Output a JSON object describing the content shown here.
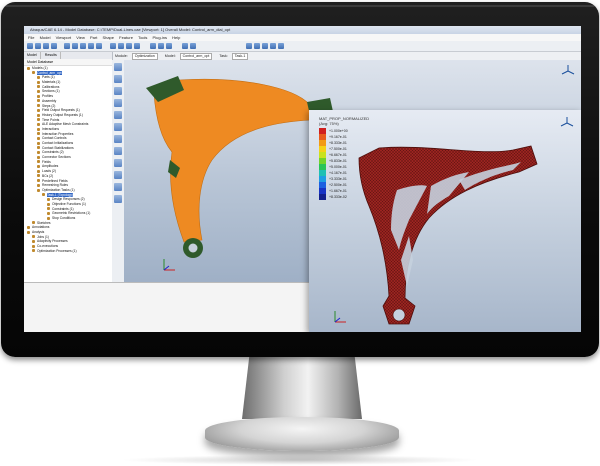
{
  "window": {
    "title": "Abaqus/CAE 6.14 - Model Database: C:\\TEMP\\Dual-Lines.cae [Viewport: 1]  Overall Model: Control_arm_dial_opt"
  },
  "menu": [
    "File",
    "Model",
    "Viewport",
    "View",
    "Part",
    "Shape",
    "Feature",
    "Tools",
    "Plug-ins",
    "Help"
  ],
  "toolbar2": {
    "module_label": "Module:",
    "module_value": "Optimization",
    "model_label": "Model:",
    "model_value": "Control_arm_opt",
    "task_label": "Task:",
    "task_value": "Task-1"
  },
  "tabs": [
    "Model",
    "Results"
  ],
  "tree": {
    "header": "Model Database",
    "items": [
      {
        "label": "Models (1)",
        "indent": 0
      },
      {
        "label": "Control_arm_opt",
        "indent": 1,
        "selected": true
      },
      {
        "label": "Parts (1)",
        "indent": 2
      },
      {
        "label": "Materials (1)",
        "indent": 2
      },
      {
        "label": "Calibrations",
        "indent": 2
      },
      {
        "label": "Sections (1)",
        "indent": 2
      },
      {
        "label": "Profiles",
        "indent": 2
      },
      {
        "label": "Assembly",
        "indent": 2
      },
      {
        "label": "Steps (2)",
        "indent": 2
      },
      {
        "label": "Field Output Requests (1)",
        "indent": 2
      },
      {
        "label": "History Output Requests (1)",
        "indent": 2
      },
      {
        "label": "Time Points",
        "indent": 2
      },
      {
        "label": "ALE Adaptive Mesh Constraints",
        "indent": 2
      },
      {
        "label": "Interactions",
        "indent": 2
      },
      {
        "label": "Interaction Properties",
        "indent": 2
      },
      {
        "label": "Contact Controls",
        "indent": 2
      },
      {
        "label": "Contact Initializations",
        "indent": 2
      },
      {
        "label": "Contact Stabilizations",
        "indent": 2
      },
      {
        "label": "Constraints (2)",
        "indent": 2
      },
      {
        "label": "Connector Sections",
        "indent": 2
      },
      {
        "label": "Fields",
        "indent": 2
      },
      {
        "label": "Amplitudes",
        "indent": 2
      },
      {
        "label": "Loads (2)",
        "indent": 2
      },
      {
        "label": "BCs (2)",
        "indent": 2
      },
      {
        "label": "Predefined Fields",
        "indent": 2
      },
      {
        "label": "Remeshing Rules",
        "indent": 2
      },
      {
        "label": "Optimization Tasks (1)",
        "indent": 2
      },
      {
        "label": "Task-1 (Topology)",
        "indent": 3,
        "selected": true
      },
      {
        "label": "Design Responses (2)",
        "indent": 4
      },
      {
        "label": "Objective Functions (1)",
        "indent": 4
      },
      {
        "label": "Constraints (1)",
        "indent": 4
      },
      {
        "label": "Geometric Restrictions (1)",
        "indent": 4
      },
      {
        "label": "Stop Conditions",
        "indent": 4
      },
      {
        "label": "Sketches",
        "indent": 1
      },
      {
        "label": "Annotations",
        "indent": 0
      },
      {
        "label": "Analysis",
        "indent": 0
      },
      {
        "label": "Jobs (1)",
        "indent": 1
      },
      {
        "label": "Adaptivity Processes",
        "indent": 1
      },
      {
        "label": "Co-executions",
        "indent": 1
      },
      {
        "label": "Optimization Processes (1)",
        "indent": 1
      }
    ]
  },
  "result": {
    "title": "MAT_PROP_NORMALIZED",
    "subtitle": "(Avg: 75%)",
    "legend": [
      {
        "color": "#d01f1f",
        "value": "+1.000e+00"
      },
      {
        "color": "#e85b1d",
        "value": "+9.167e-01"
      },
      {
        "color": "#f29a16",
        "value": "+8.333e-01"
      },
      {
        "color": "#f5d118",
        "value": "+7.500e-01"
      },
      {
        "color": "#c9e21e",
        "value": "+6.667e-01"
      },
      {
        "color": "#73d32a",
        "value": "+5.833e-01"
      },
      {
        "color": "#29c457",
        "value": "+5.000e-01"
      },
      {
        "color": "#1fc0b3",
        "value": "+4.167e-01"
      },
      {
        "color": "#1e9ee3",
        "value": "+3.333e-01"
      },
      {
        "color": "#1c60e0",
        "value": "+2.500e-01"
      },
      {
        "color": "#1733c4",
        "value": "+1.667e-01"
      },
      {
        "color": "#12208c",
        "value": "+8.333e-02"
      }
    ]
  },
  "colors": {
    "part_orange": "#ee8a22",
    "part_green": "#2f5a2b",
    "result_red": "#9a2420",
    "mesh_dark": "#4e0e0b"
  }
}
